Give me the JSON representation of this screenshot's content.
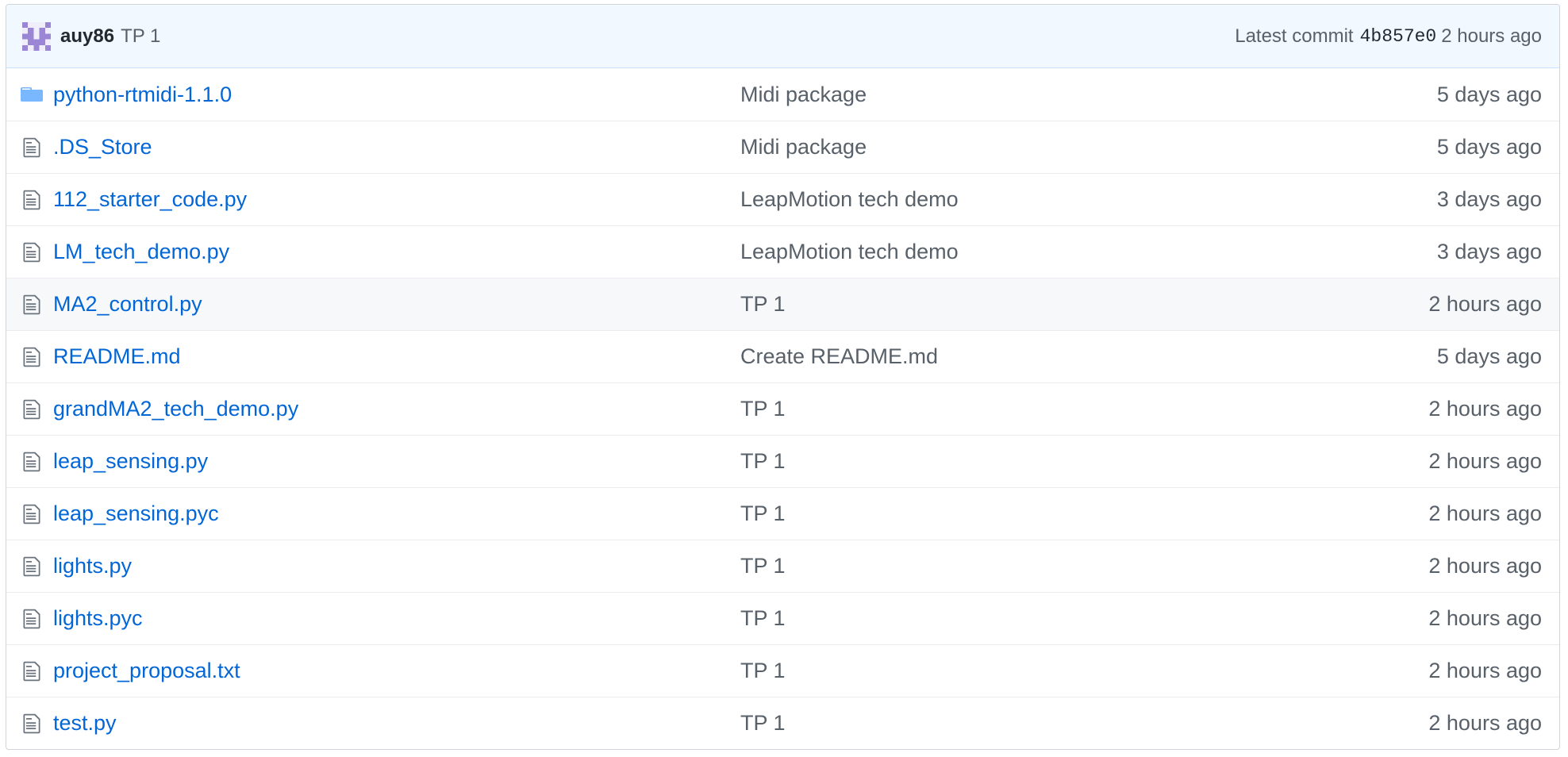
{
  "commit": {
    "author": "auy86",
    "message": "TP 1",
    "latest_label": "Latest commit",
    "sha": "4b857e0",
    "age": "2 hours ago",
    "avatar_icon": "identicon-avatar"
  },
  "colors": {
    "link": "#0366d6",
    "muted": "#586069",
    "header_bg": "#f1f8ff",
    "row_highlight": "#f6f8fa",
    "folder_icon": "#79b8ff"
  },
  "files": [
    {
      "icon": "folder-icon",
      "name": "python-rtmidi-1.1.0",
      "message": "Midi package",
      "age": "5 days ago"
    },
    {
      "icon": "file-icon",
      "name": ".DS_Store",
      "message": "Midi package",
      "age": "5 days ago"
    },
    {
      "icon": "file-icon",
      "name": "112_starter_code.py",
      "message": "LeapMotion tech demo",
      "age": "3 days ago"
    },
    {
      "icon": "file-icon",
      "name": "LM_tech_demo.py",
      "message": "LeapMotion tech demo",
      "age": "3 days ago"
    },
    {
      "icon": "file-icon",
      "name": "MA2_control.py",
      "message": "TP 1",
      "age": "2 hours ago"
    },
    {
      "icon": "file-icon",
      "name": "README.md",
      "message": "Create README.md",
      "age": "5 days ago"
    },
    {
      "icon": "file-icon",
      "name": "grandMA2_tech_demo.py",
      "message": "TP 1",
      "age": "2 hours ago"
    },
    {
      "icon": "file-icon",
      "name": "leap_sensing.py",
      "message": "TP 1",
      "age": "2 hours ago"
    },
    {
      "icon": "file-icon",
      "name": "leap_sensing.pyc",
      "message": "TP 1",
      "age": "2 hours ago"
    },
    {
      "icon": "file-icon",
      "name": "lights.py",
      "message": "TP 1",
      "age": "2 hours ago"
    },
    {
      "icon": "file-icon",
      "name": "lights.pyc",
      "message": "TP 1",
      "age": "2 hours ago"
    },
    {
      "icon": "file-icon",
      "name": "project_proposal.txt",
      "message": "TP 1",
      "age": "2 hours ago"
    },
    {
      "icon": "file-icon",
      "name": "test.py",
      "message": "TP 1",
      "age": "2 hours ago"
    }
  ]
}
